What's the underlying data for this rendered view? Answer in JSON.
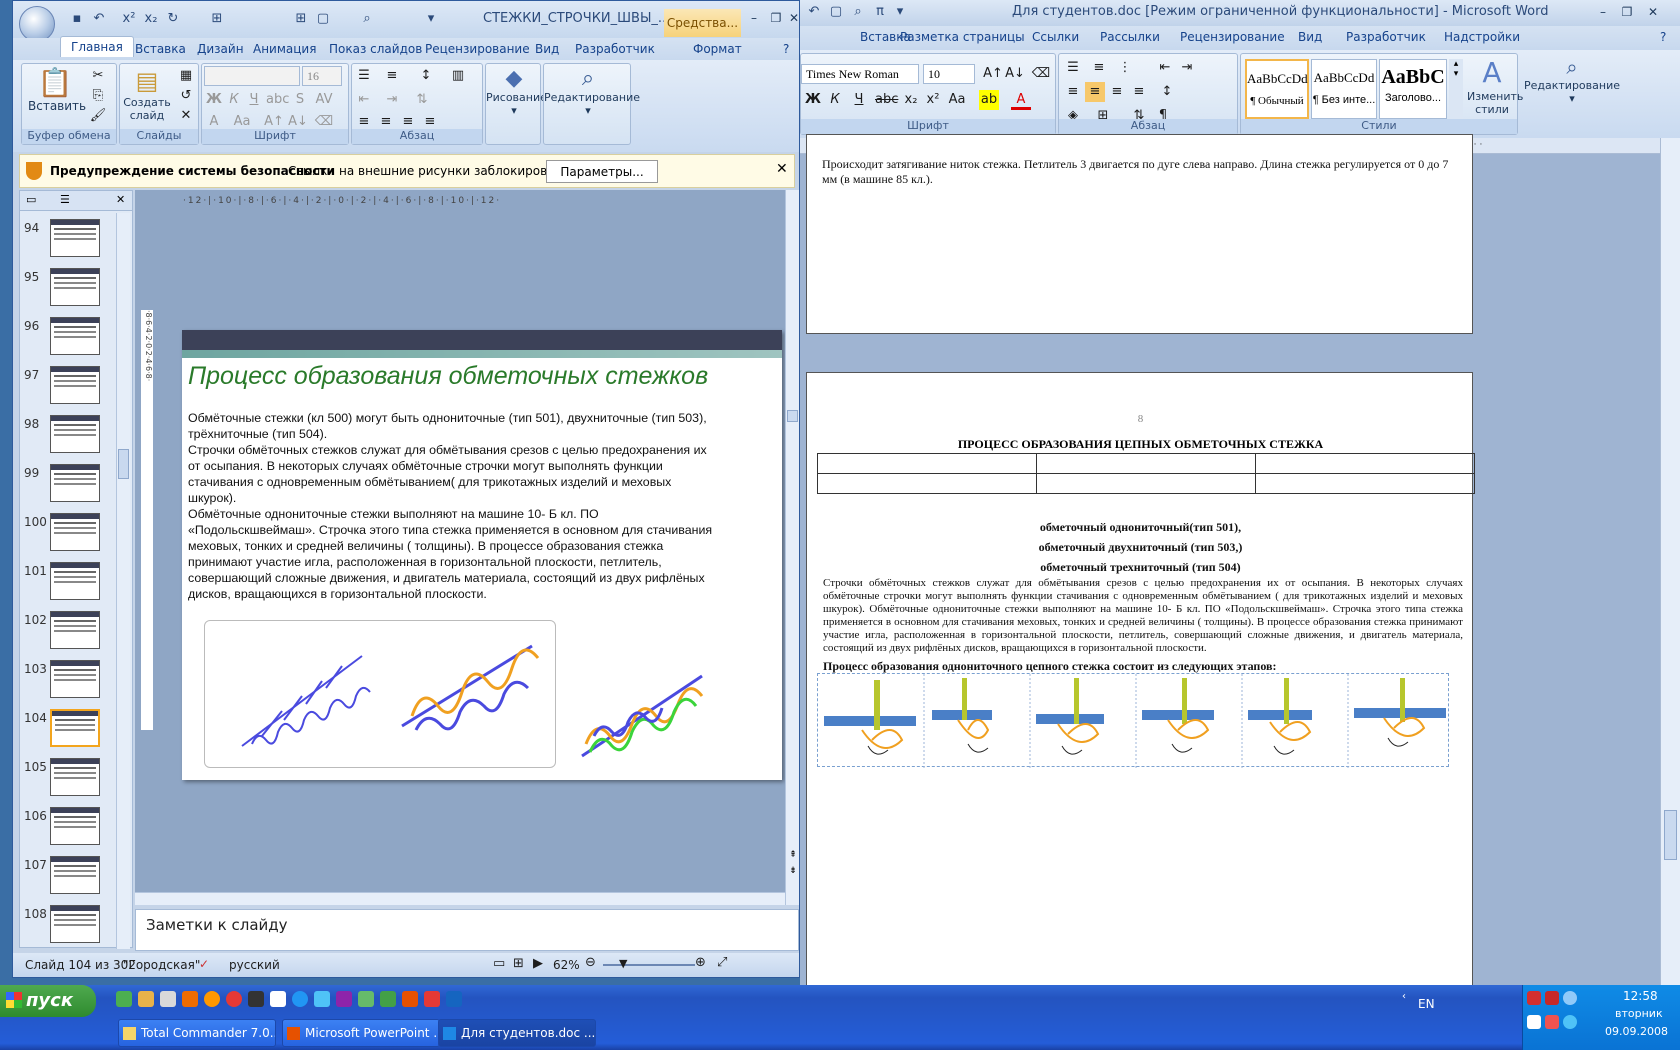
{
  "word": {
    "title": "Для студентов.doc [Режим ограниченной функциональности] - Microsoft Word",
    "tabs": [
      "Вставка",
      "Разметка страницы",
      "Ссылки",
      "Рассылки",
      "Рецензирование",
      "Вид",
      "Разработчик",
      "Надстройки"
    ],
    "font_name": "Times New Roman",
    "font_size": "10",
    "styles": [
      {
        "sample": "AaBbCcDd",
        "label": "¶ Обычный"
      },
      {
        "sample": "AaBbCcDd",
        "label": "¶ Без инте..."
      },
      {
        "sample": "AaBbC",
        "label": "Заголово..."
      }
    ],
    "change_styles": "Изменить стили",
    "editing": "Редактирование",
    "group_font": "Шрифт",
    "group_paragraph": "Абзац",
    "group_styles": "Стили",
    "page1_text": "Происходит затягивание ниток стежка. Петлитель 3 двигается по дуге слева направо. Длина стежка регулируется от 0 до 7 мм (в машине 85 кл.).",
    "page_number": "8",
    "heading": "ПРОЦЕСС ОБРАЗОВАНИЯ ЦЕПНЫХ ОБМЕТОЧНЫХ СТЕЖКА",
    "type_lines": [
      "обметочный однониточный(тип 501),",
      "обметочный двухниточный (тип 503,)",
      "обметочный трехниточный (тип 504)"
    ],
    "paragraph": "Строчки обмёточных стежков служат для обмётывания срезов с целью предохранения их от осыпания. В некоторых случаях обмёточные строчки могут выполнять функции стачивания с одновременным обмётыванием ( для трикотажных изделий и меховых шкурок). Обмёточные однониточные стежки выполняют на машине 10- Б кл. ПО «Подольскшвеймаш». Строчка этого типа стежка применяется в основном для стачивания меховых, тонких и средней величины ( толщины). В процессе образования стежка принимают участие игла, расположенная в горизонтальной плоскости, петлитель, совершающий сложные движения, и двигатель материала, состоящий из двух рифлёных дисков, вращающихся в горизонтальной плоскости.",
    "stages_heading": "Процесс образования однониточного цепного стежка состоит из следующих этапов:"
  },
  "ppt": {
    "title": "СТЕЖКИ_СТРОЧКИ_ШВЫ_...",
    "context_tab": "Средства...",
    "format_tab": "Формат",
    "tabs": [
      "Главная",
      "Вставка",
      "Дизайн",
      "Анимация",
      "Показ слайдов",
      "Рецензирование",
      "Вид",
      "Разработчик"
    ],
    "paste": "Вставить",
    "new_slide": "Создать слайд",
    "drawing": "Рисование",
    "editing": "Редактирование",
    "groups": [
      "Буфер обмена",
      "Слайды",
      "Шрифт",
      "Абзац"
    ],
    "font_size": "16",
    "security_title": "Предупреждение системы безопасности",
    "security_msg": "Ссылки на внешние рисунки заблокированы",
    "security_button": "Параметры...",
    "slide_numbers": [
      "94",
      "95",
      "96",
      "97",
      "98",
      "99",
      "100",
      "101",
      "102",
      "103",
      "104",
      "105",
      "106",
      "107",
      "108"
    ],
    "selected_slide": "104",
    "slide_title": "Процесс образования обметочных  стежков",
    "slide_body": [
      "Обмёточные стежки (кл 500)  могут быть однониточные (тип 501),  двухниточные (тип 503),",
      "трёхниточные (тип 504).",
      "Строчки обмёточных стежков служат для обмётывания  срезов с целью предохранения их",
      "от осыпания. В некоторых случаях обмёточные строчки могут выполнять функции",
      "стачивания  с одновременным обмётыванием( для трикотажных изделий и меховых",
      "шкурок).",
      "Обмёточные однониточные стежки выполняют на машине  10- Б кл. ПО",
      "«Подольскшвеймаш». Строчка этого типа стежка применяется в основном для стачивания",
      "меховых, тонких и средней величины ( толщины).  В процессе образования стежка",
      "принимают участие игла, расположенная в горизонтальной плоскости, петлитель,",
      "совершающий сложные движения,  и двигатель материала,  состоящий из двух рифлёных",
      "дисков, вращающихся в горизонтальной плоскости."
    ],
    "notes": "Заметки к слайду",
    "status_slide": "Слайд 104 из 302",
    "status_theme": "\"Городская\"",
    "status_lang": "русский",
    "zoom": "62%"
  },
  "taskbar": {
    "start": "пуск",
    "tasks": [
      "Total Commander 7.0...",
      "Microsoft PowerPoint ...",
      "Для студентов.doc ..."
    ],
    "lang": "EN",
    "time": "12:58",
    "day": "вторник",
    "date": "09.09.2008"
  },
  "colors": {
    "slide_title": "#2a7a2a",
    "stitch_blue": "#4a4adf",
    "stitch_orange": "#f0a020",
    "stitch_green": "#3bd43b"
  }
}
